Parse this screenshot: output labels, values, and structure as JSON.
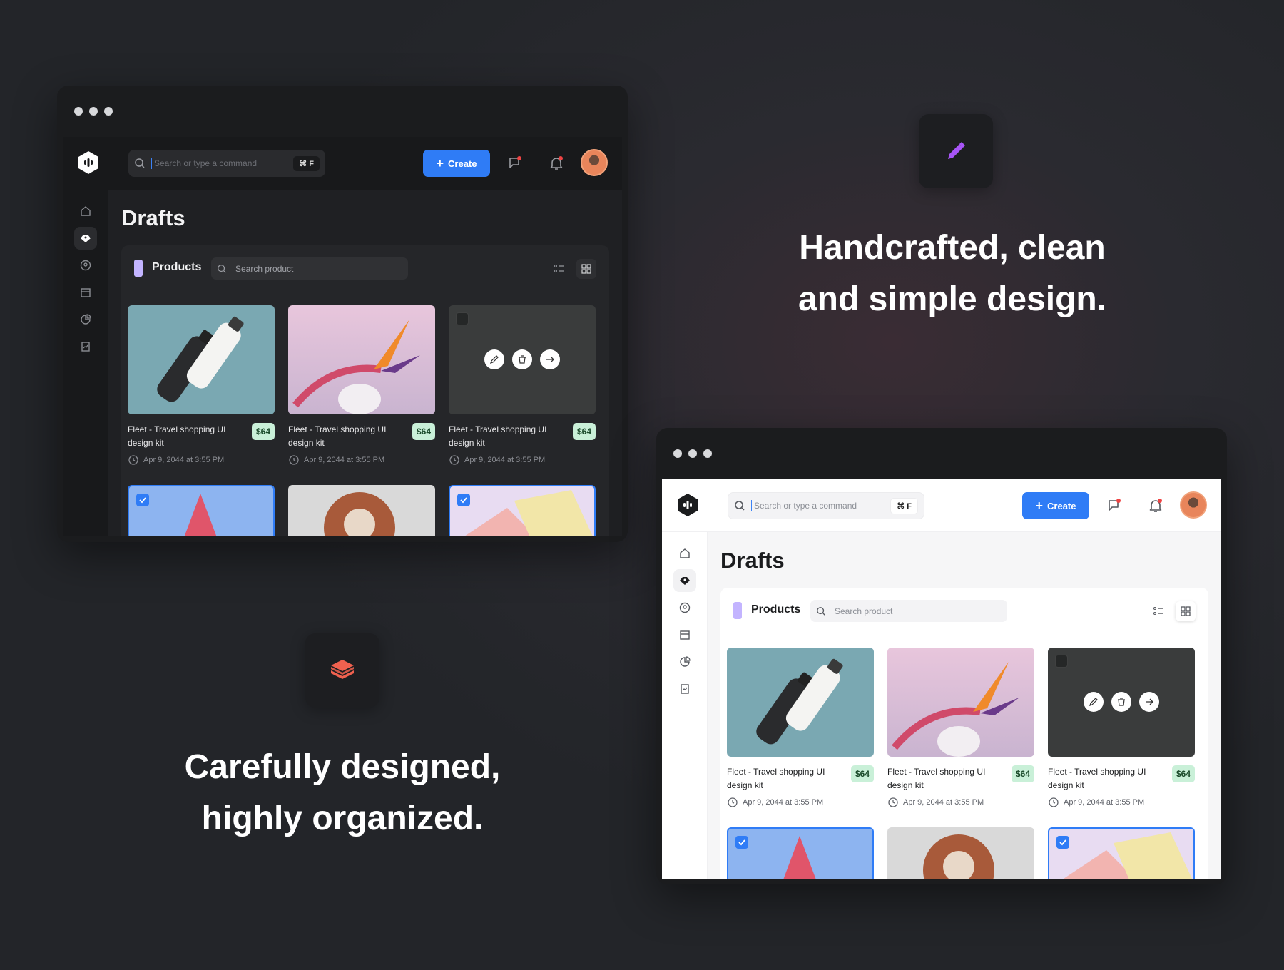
{
  "app": {
    "search_placeholder": "Search or type a command",
    "shortcut": "⌘ F",
    "create_label": "Create",
    "page_title": "Drafts",
    "panel_title": "Products",
    "product_search_placeholder": "Search product"
  },
  "cards": [
    {
      "title": "Fleet - Travel shopping UI design kit",
      "price": "$64",
      "date": "Apr 9, 2044 at 3:55 PM"
    },
    {
      "title": "Fleet - Travel shopping UI design kit",
      "price": "$64",
      "date": "Apr 9, 2044 at 3:55 PM"
    },
    {
      "title": "Fleet - Travel shopping UI design kit",
      "price": "$64",
      "date": "Apr 9, 2044 at 3:55 PM"
    }
  ],
  "features": {
    "top_headline_line1": "Handcrafted, clean",
    "top_headline_line2": "and simple design.",
    "bottom_headline_line1": "Carefully designed,",
    "bottom_headline_line2": "highly organized."
  },
  "colors": {
    "accent": "#2f7cf6",
    "price_badge": "#c9f0d8",
    "product_marker": "#c3b4ff",
    "pencil_icon": "#a855f7",
    "layers_icon": "#f0614f"
  },
  "icons": {
    "sidebar": [
      "home-icon",
      "tag-icon",
      "user-circle-icon",
      "store-icon",
      "pie-chart-icon",
      "report-icon"
    ]
  }
}
